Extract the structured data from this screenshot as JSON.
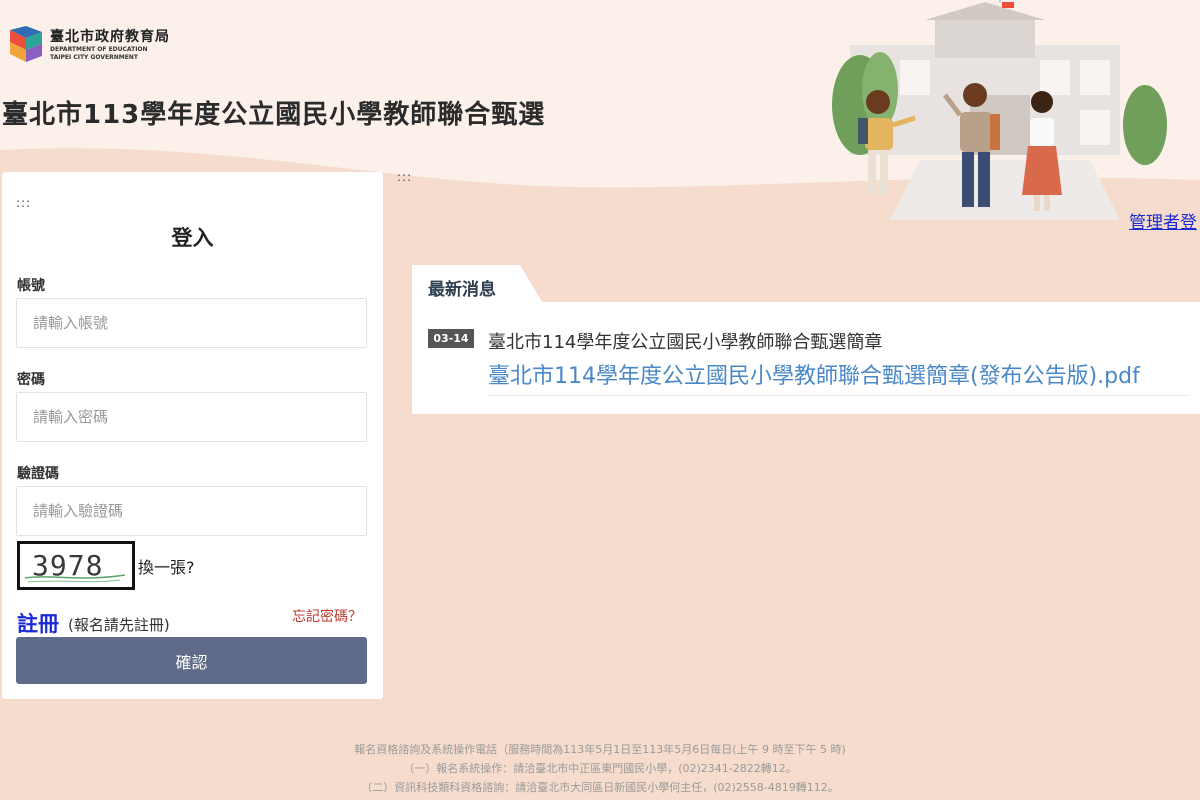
{
  "header": {
    "logo_cn": "臺北市政府教育局",
    "logo_en_line1": "DEPARTMENT OF EDUCATION",
    "logo_en_line2": "TAIPEI CITY GOVERNMENT",
    "site_title": "臺北市113學年度公立國民小學教師聯合甄選",
    "admin_link": "管理者登"
  },
  "decor": {
    "dots": ":::"
  },
  "login": {
    "title": "登入",
    "account_label": "帳號",
    "account_placeholder": "請輸入帳號",
    "password_label": "密碼",
    "password_placeholder": "請輸入密碼",
    "captcha_label": "驗證碼",
    "captcha_placeholder": "請輸入驗證碼",
    "captcha_code": "3978",
    "captcha_refresh": "換一張?",
    "register_label": "註冊",
    "register_note": "(報名請先註冊)",
    "forgot_label": "忘記密碼？",
    "submit_label": "確認"
  },
  "news": {
    "tab_label": "最新消息",
    "items": [
      {
        "date": "03-14",
        "title": "臺北市114學年度公立國民小學教師聯合甄選簡章",
        "link_text": "臺北市114學年度公立國民小學教師聯合甄選簡章(發布公告版).pdf"
      }
    ]
  },
  "footer": {
    "line1": "報名資格諮詢及系統操作電話（服務時間為113年5月1日至113年5月6日每日(上午 9 時至下午 5 時)",
    "line2": "（一）報名系統操作：請洽臺北市中正區東門國民小學，(02)2341-2822轉12。",
    "line3": "（二）資訊科技類科資格諮詢：請洽臺北市大同區日新國民小學何主任，(02)2558-4819轉112。"
  },
  "colors": {
    "background": "#f5dccd",
    "header_band": "#fbf0ea",
    "link_blue": "#1a2bd6",
    "news_link": "#4a88c7",
    "button": "#5f6b88",
    "forgot_red": "#c0392b"
  }
}
